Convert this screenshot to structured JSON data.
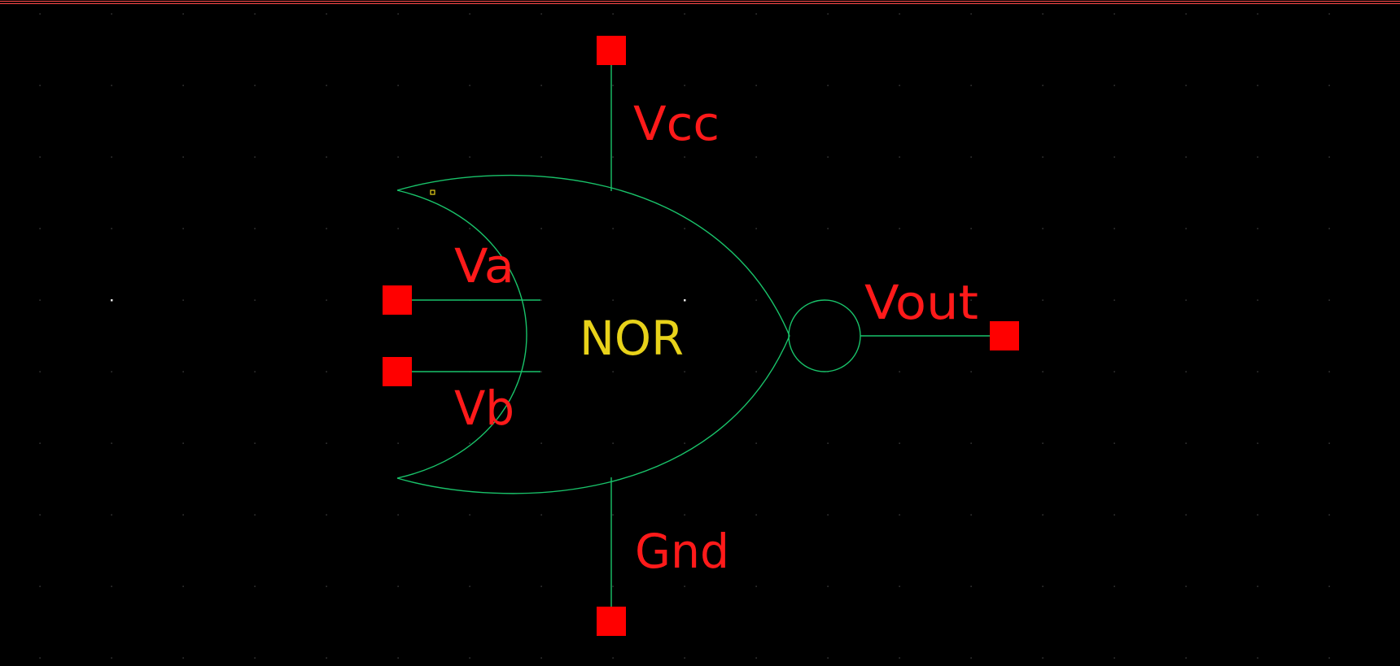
{
  "colors": {
    "background": "#000000",
    "grid_dot": "#5a5a5a",
    "grid_origin_dot": "#e8e8e8",
    "wire": "#19c36a",
    "pin": "#ff0000",
    "pin_label": "#ff1a1a",
    "symbol_label": "#e8d21a",
    "selection_marker": "#e8d21a",
    "top_border": "#ff4a4a"
  },
  "symbol": {
    "name": "NOR"
  },
  "pins": {
    "vcc": "Vcc",
    "gnd": "Gnd",
    "va": "Va",
    "vb": "Vb",
    "vout": "Vout"
  }
}
